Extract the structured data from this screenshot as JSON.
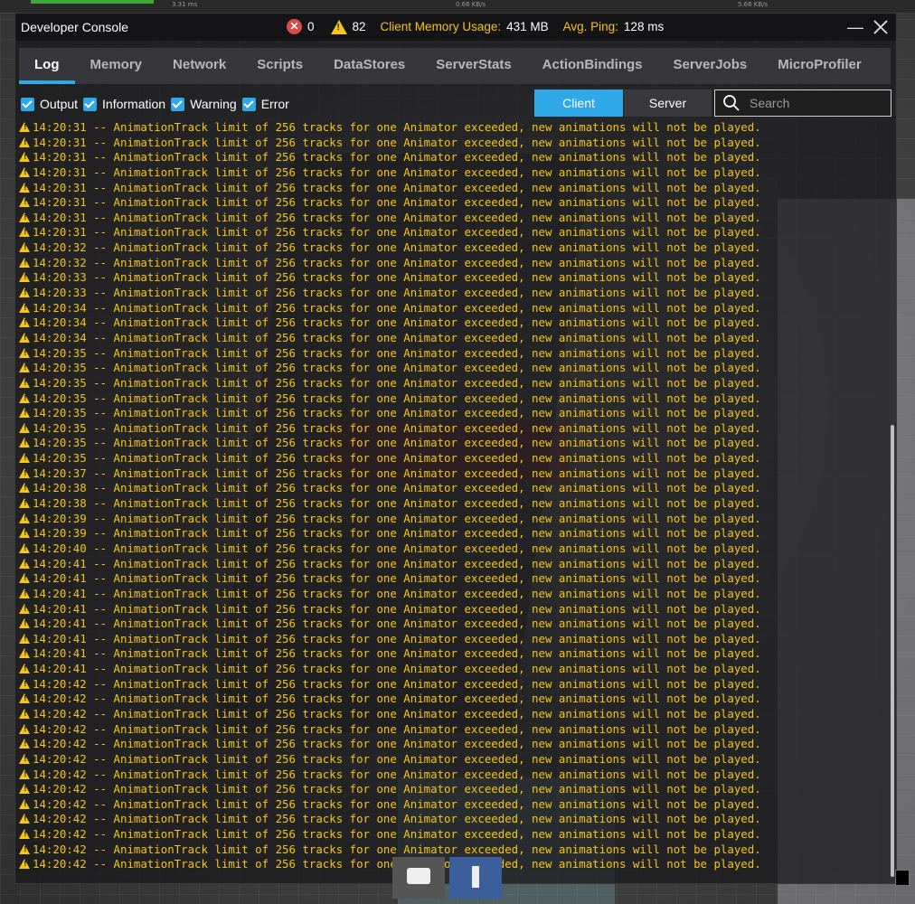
{
  "background": {
    "stats": [
      "3.31 ms",
      "0.66 KB/s",
      "5.66 KB/s"
    ]
  },
  "window": {
    "title": "Developer Console",
    "error_count": "0",
    "warning_count": "82",
    "memory_label": "Client Memory Usage:",
    "memory_value": "431 MB",
    "ping_label": "Avg. Ping:",
    "ping_value": "128 ms"
  },
  "tabs": [
    {
      "label": "Log",
      "active": true
    },
    {
      "label": "Memory"
    },
    {
      "label": "Network"
    },
    {
      "label": "Scripts"
    },
    {
      "label": "DataStores"
    },
    {
      "label": "ServerStats"
    },
    {
      "label": "ActionBindings"
    },
    {
      "label": "ServerJobs"
    },
    {
      "label": "MicroProfiler"
    }
  ],
  "filters": [
    "Output",
    "Information",
    "Warning",
    "Error"
  ],
  "source": {
    "client": "Client",
    "server": "Server"
  },
  "search": {
    "placeholder": "Search"
  },
  "colors": {
    "accent": "#2fa8e8",
    "warning": "#f5c518",
    "error": "#d94a4a"
  },
  "log": {
    "separator": " -- ",
    "message": "AnimationTrack limit of 256 tracks for one Animator exceeded, new animations will not be played.",
    "timestamps": [
      "14:20:31",
      "14:20:31",
      "14:20:31",
      "14:20:31",
      "14:20:31",
      "14:20:31",
      "14:20:31",
      "14:20:31",
      "14:20:32",
      "14:20:32",
      "14:20:33",
      "14:20:33",
      "14:20:34",
      "14:20:34",
      "14:20:34",
      "14:20:35",
      "14:20:35",
      "14:20:35",
      "14:20:35",
      "14:20:35",
      "14:20:35",
      "14:20:35",
      "14:20:35",
      "14:20:37",
      "14:20:38",
      "14:20:38",
      "14:20:39",
      "14:20:39",
      "14:20:40",
      "14:20:41",
      "14:20:41",
      "14:20:41",
      "14:20:41",
      "14:20:41",
      "14:20:41",
      "14:20:41",
      "14:20:41",
      "14:20:42",
      "14:20:42",
      "14:20:42",
      "14:20:42",
      "14:20:42",
      "14:20:42",
      "14:20:42",
      "14:20:42",
      "14:20:42",
      "14:20:42",
      "14:20:42",
      "14:20:42",
      "14:20:42"
    ]
  }
}
